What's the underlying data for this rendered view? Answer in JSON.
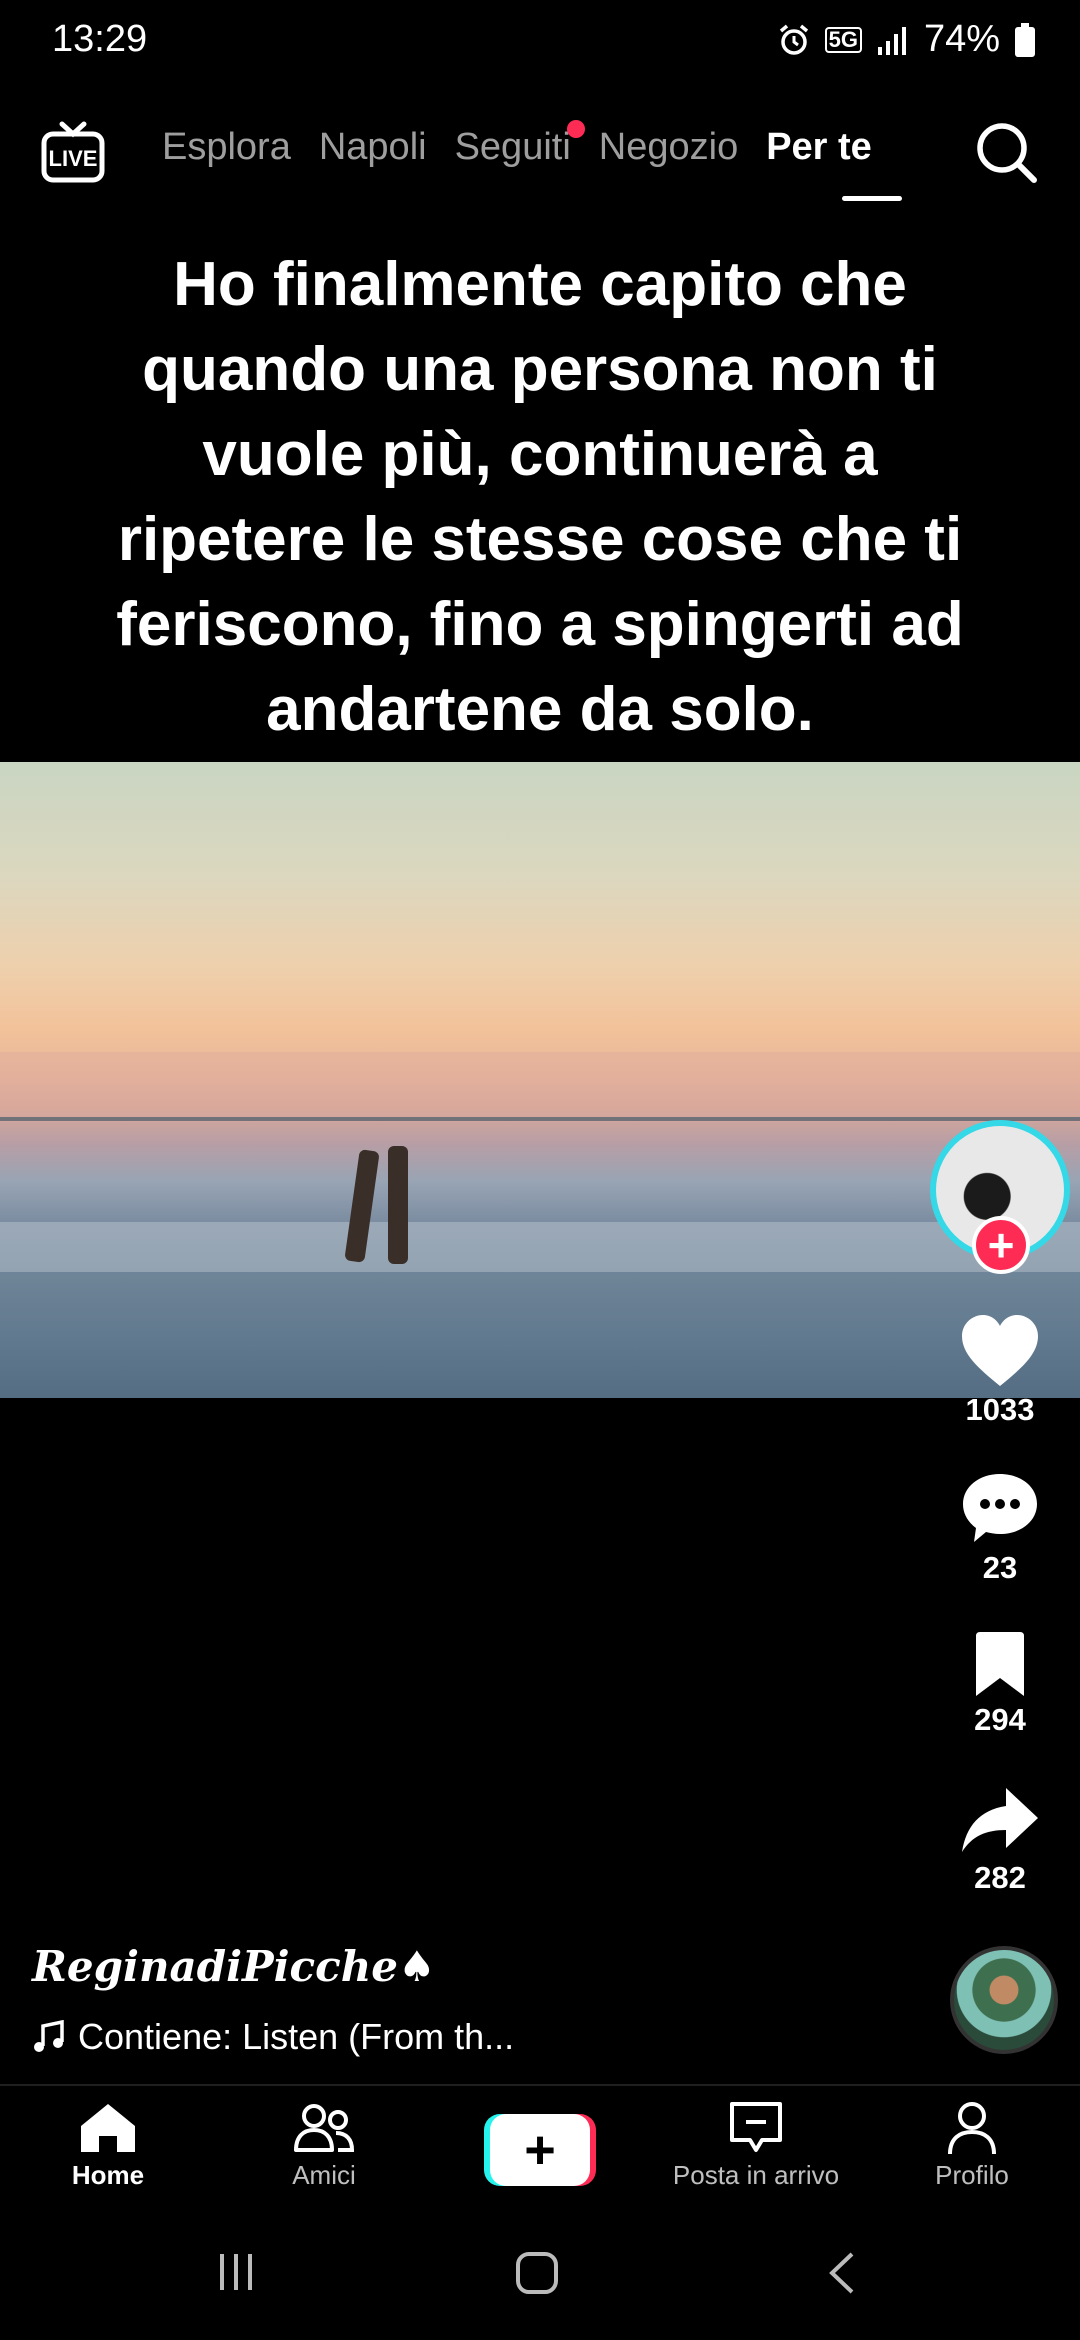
{
  "status_bar": {
    "time": "13:29",
    "network": "5G",
    "battery": "74%"
  },
  "top_nav": {
    "live_label": "LIVE",
    "tabs": [
      {
        "label": "Esplora",
        "active": false
      },
      {
        "label": "Napoli",
        "active": false
      },
      {
        "label": "Seguiti",
        "active": false,
        "notification_dot": true
      },
      {
        "label": "Negozio",
        "active": false
      },
      {
        "label": "Per te",
        "active": true
      }
    ]
  },
  "video": {
    "caption": "Ho finalmente capito che\nquando una persona non ti\nvuole più, continuerà a\nripetere le stesse cose che ti\nferiscono, fino a spingerti ad\nandartene da solo."
  },
  "actions": {
    "likes": "1033",
    "comments": "23",
    "saves": "294",
    "shares": "282"
  },
  "post": {
    "username": "ReginadiPicche♠",
    "music": "Contiene: Listen (From th..."
  },
  "bottom_nav": {
    "home": "Home",
    "friends": "Amici",
    "inbox": "Posta in arrivo",
    "profile": "Profilo"
  },
  "colors": {
    "accent": "#fe2c55",
    "cyan": "#25f4ee",
    "background": "#000000"
  }
}
